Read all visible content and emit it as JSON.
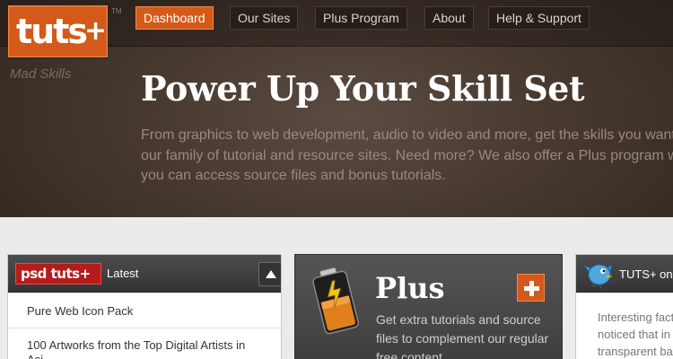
{
  "brand": {
    "logo_text": "tuts",
    "logo_plus": "+",
    "trademark": "TM",
    "tagline": "Mad Skills"
  },
  "nav": [
    {
      "label": "Dashboard",
      "active": true
    },
    {
      "label": "Our Sites",
      "active": false
    },
    {
      "label": "Plus Program",
      "active": false
    },
    {
      "label": "About",
      "active": false
    },
    {
      "label": "Help & Support",
      "active": false
    }
  ],
  "hero": {
    "title": "Power Up Your Skill Set",
    "description_lines": [
      "From graphics to web development, audio to video and more, get the skills you want fro",
      "our family of tutorial and resource sites. Need more? We also offer a Plus program whe",
      "you can access source files and bonus tutorials."
    ]
  },
  "psd_panel": {
    "badge": "psd tuts+",
    "heading": "Latest",
    "items": [
      "Pure Web Icon Pack",
      "100 Artworks from the Top Digital Artists in",
      "Asi..."
    ]
  },
  "plus_panel": {
    "title": "Plus",
    "description_lines": [
      "Get extra tutorials and source",
      "files to complement our regular",
      "free content."
    ]
  },
  "twitter_panel": {
    "heading": "TUTS+ on",
    "text_lines": [
      "Interesting fact",
      "noticed that in",
      "transparent ba"
    ]
  },
  "colors": {
    "accent": "#d35a1a",
    "psd_red": "#b41c1c",
    "hero_bg": "#46392f",
    "page_bg": "#ebebeb"
  }
}
